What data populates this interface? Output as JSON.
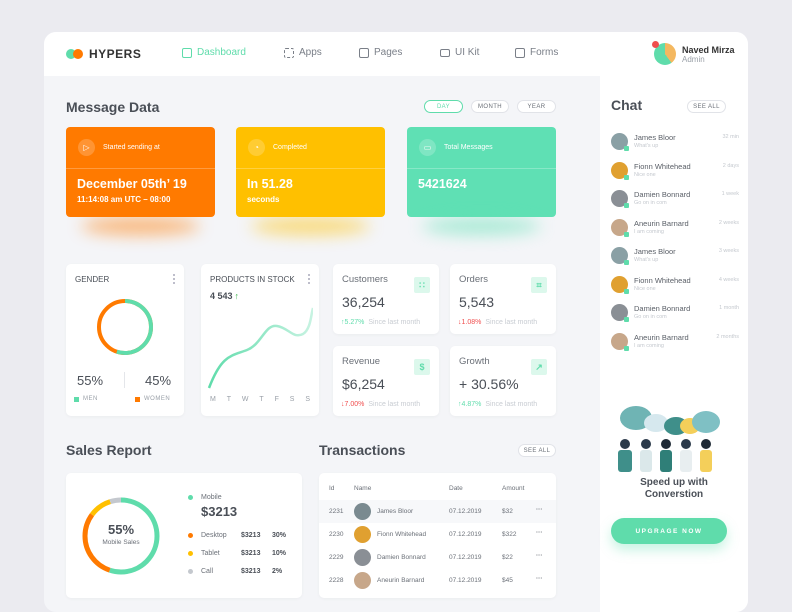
{
  "brand": {
    "name": "HYPERS",
    "colors": {
      "accent": "#5fdcab",
      "orange": "#ff7a00",
      "yellow": "#ffc000",
      "red": "#f04e4e",
      "gray": "#c4c8ce"
    }
  },
  "nav": [
    {
      "label": "Dashboard",
      "icon": "dashboard-icon",
      "active": true
    },
    {
      "label": "Apps",
      "icon": "apps-icon",
      "active": false
    },
    {
      "label": "Pages",
      "icon": "pages-icon",
      "active": false
    },
    {
      "label": "UI Kit",
      "icon": "uikit-icon",
      "active": false
    },
    {
      "label": "Forms",
      "icon": "forms-icon",
      "active": false
    }
  ],
  "user": {
    "name": "Naved Mirza",
    "role": "Admin"
  },
  "message_data": {
    "title": "Message Data",
    "ranges": [
      "DAY",
      "MONTH",
      "YEAR"
    ],
    "active_range": "DAY",
    "cards": [
      {
        "label": "Started sending at",
        "value": "December 05th’ 19",
        "sub": "11:14:08 am UTC – 08:00",
        "icon": "play-icon",
        "color": "#ff7a00"
      },
      {
        "label": "Completed",
        "value": "In 51.28",
        "sub": "seconds",
        "icon": "clock-icon",
        "color": "#ffc000"
      },
      {
        "label": "Total Messages",
        "value": "5421624",
        "sub": "",
        "icon": "message-icon",
        "color": "#5fe0b4"
      }
    ]
  },
  "gender": {
    "title": "GENDER",
    "men_pct": "55%",
    "women_pct": "45%",
    "men_label": "MEN",
    "women_label": "WOMEN",
    "men_share": 0.55
  },
  "products": {
    "title": "PRODUCTS IN STOCK",
    "value": "4 543",
    "days": [
      "M",
      "T",
      "W",
      "T",
      "F",
      "S",
      "S"
    ]
  },
  "stats": [
    {
      "label": "Customers",
      "value": "36,254",
      "change": "5.27%",
      "dir": "up",
      "since": "Since last month",
      "icon": "users-icon",
      "glyph": "∷"
    },
    {
      "label": "Orders",
      "value": "5,543",
      "change": "1.08%",
      "dir": "down",
      "since": "Since last month",
      "icon": "cart-icon",
      "glyph": "⌗"
    },
    {
      "label": "Revenue",
      "value": "$6,254",
      "change": "7.00%",
      "dir": "down",
      "since": "Since last month",
      "icon": "dollar-icon",
      "glyph": "$"
    },
    {
      "label": "Growth",
      "value": "+ 30.56%",
      "change": "4.87%",
      "dir": "up",
      "since": "Since last month",
      "icon": "growth-icon",
      "glyph": "↗"
    }
  ],
  "sales": {
    "title": "Sales Report",
    "center_pct": "55%",
    "center_label": "Mobile Sales",
    "mobile_label": "Mobile",
    "mobile_value": "$3213",
    "rows": [
      {
        "label": "Desktop",
        "amount": "$3213",
        "pct": "30%",
        "color": "#ff7a00"
      },
      {
        "label": "Tablet",
        "amount": "$3213",
        "pct": "10%",
        "color": "#ffc000"
      },
      {
        "label": "Call",
        "amount": "$3213",
        "pct": "2%",
        "color": "#c4c8ce"
      }
    ]
  },
  "transactions": {
    "title": "Transactions",
    "see_all": "SEE ALL",
    "headers": [
      "Id",
      "Name",
      "Date",
      "Amount"
    ],
    "rows": [
      {
        "id": "2231",
        "name": "James Bloor",
        "date": "07.12.2019",
        "amount": "$32"
      },
      {
        "id": "2230",
        "name": "Fionn Whitehead",
        "date": "07.12.2019",
        "amount": "$322"
      },
      {
        "id": "2229",
        "name": "Damien Bonnard",
        "date": "07.12.2019",
        "amount": "$22"
      },
      {
        "id": "2228",
        "name": "Aneurin Barnard",
        "date": "07.12.2019",
        "amount": "$45"
      }
    ]
  },
  "chat": {
    "title": "Chat",
    "see_all": "SEE ALL",
    "items": [
      {
        "name": "James Bloor",
        "msg": "What's up",
        "time": "32 min"
      },
      {
        "name": "Fionn Whitehead",
        "msg": "Nice one",
        "time": "2 days"
      },
      {
        "name": "Damien Bonnard",
        "msg": "Go on in com",
        "time": "1 week"
      },
      {
        "name": "Aneurin Barnard",
        "msg": "I am coming",
        "time": "2 weeks"
      },
      {
        "name": "James Bloor",
        "msg": "What's up",
        "time": "3 weeks"
      },
      {
        "name": "Fionn Whitehead",
        "msg": "Nice one",
        "time": "4 weeks"
      },
      {
        "name": "Damien Bonnard",
        "msg": "Go on in com",
        "time": "1 month"
      },
      {
        "name": "Aneurin Barnard",
        "msg": "I am coming",
        "time": "2 months"
      }
    ],
    "promo_title": "Speed up with Converstion",
    "upgrade_label": "UPGRAGE NOW"
  }
}
